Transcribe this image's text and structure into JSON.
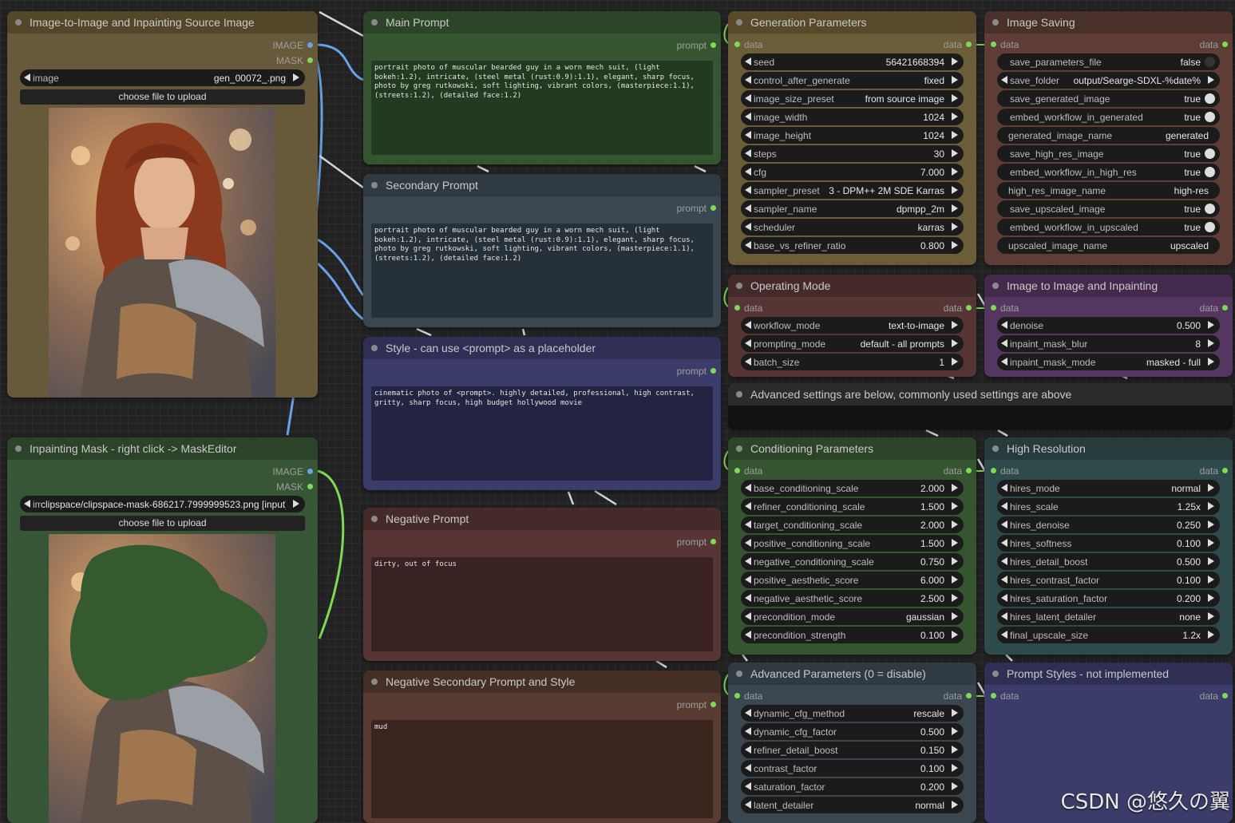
{
  "nodes": {
    "source_image": {
      "title": "Image-to-Image and Inpainting Source Image",
      "outputs": [
        "IMAGE",
        "MASK"
      ],
      "image_widget": {
        "label": "image",
        "value": "gen_00072_.png"
      },
      "upload_label": "choose file to upload"
    },
    "inpaint_mask": {
      "title": "Inpainting Mask - right click -> MaskEditor",
      "outputs": [
        "IMAGE",
        "MASK"
      ],
      "image_widget": {
        "label": "im",
        "value": "clipspace/clipspace-mask-686217.7999999523.png [input]"
      },
      "upload_label": "choose file to upload"
    },
    "main_prompt": {
      "title": "Main Prompt",
      "output": "prompt",
      "text": "portrait photo of muscular bearded guy in a worn mech suit, (light bokeh:1.2), intricate, (steel metal (rust:0.9):1.1), elegant, sharp focus, photo by greg rutkowski, soft lighting, vibrant colors, (masterpiece:1.1), (streets:1.2), (detailed face:1.2)"
    },
    "secondary_prompt": {
      "title": "Secondary Prompt",
      "output": "prompt",
      "text": "portrait photo of muscular bearded guy in a worn mech suit, (light bokeh:1.2), intricate, (steel metal (rust:0.9):1.1), elegant, sharp focus, photo by greg rutkowski, soft lighting, vibrant colors, (masterpiece:1.1), (streets:1.2), (detailed face:1.2)"
    },
    "style": {
      "title": "Style - can use <prompt> as a placeholder",
      "output": "prompt",
      "text": "cinematic photo of <prompt>. highly detailed, professional, high contrast, gritty, sharp focus, high budget hollywood movie"
    },
    "negative_prompt": {
      "title": "Negative Prompt",
      "output": "prompt",
      "text": "dirty, out of focus"
    },
    "negative_secondary": {
      "title": "Negative Secondary Prompt and Style",
      "output": "prompt",
      "text": "mud"
    },
    "generation": {
      "title": "Generation Parameters",
      "in": "data",
      "out": "data",
      "widgets": [
        {
          "label": "seed",
          "value": "56421668394"
        },
        {
          "label": "control_after_generate",
          "value": "fixed"
        },
        {
          "label": "image_size_preset",
          "value": "from source image"
        },
        {
          "label": "image_width",
          "value": "1024"
        },
        {
          "label": "image_height",
          "value": "1024"
        },
        {
          "label": "steps",
          "value": "30"
        },
        {
          "label": "cfg",
          "value": "7.000"
        },
        {
          "label": "sampler_preset",
          "value": "3 - DPM++ 2M SDE Karras"
        },
        {
          "label": "sampler_name",
          "value": "dpmpp_2m"
        },
        {
          "label": "scheduler",
          "value": "karras"
        },
        {
          "label": "base_vs_refiner_ratio",
          "value": "0.800"
        }
      ]
    },
    "image_saving": {
      "title": "Image Saving",
      "in": "data",
      "out": "data",
      "widgets": [
        {
          "label": "save_parameters_file",
          "value": "false",
          "toggle": "off"
        },
        {
          "label": "save_folder",
          "value": "output/Searge-SDXL-%date%"
        },
        {
          "label": "save_generated_image",
          "value": "true",
          "toggle": "on"
        },
        {
          "label": "embed_workflow_in_generated",
          "value": "true",
          "toggle": "on"
        },
        {
          "label": "generated_image_name",
          "value": "generated"
        },
        {
          "label": "save_high_res_image",
          "value": "true",
          "toggle": "on"
        },
        {
          "label": "embed_workflow_in_high_res",
          "value": "true",
          "toggle": "on"
        },
        {
          "label": "high_res_image_name",
          "value": "high-res"
        },
        {
          "label": "save_upscaled_image",
          "value": "true",
          "toggle": "on"
        },
        {
          "label": "embed_workflow_in_upscaled",
          "value": "true",
          "toggle": "on"
        },
        {
          "label": "upscaled_image_name",
          "value": "upscaled"
        }
      ]
    },
    "operating_mode": {
      "title": "Operating Mode",
      "in": "data",
      "out": "data",
      "widgets": [
        {
          "label": "workflow_mode",
          "value": "text-to-image"
        },
        {
          "label": "prompting_mode",
          "value": "default - all prompts"
        },
        {
          "label": "batch_size",
          "value": "1"
        }
      ]
    },
    "img2img": {
      "title": "Image to Image and Inpainting",
      "in": "data",
      "out": "data",
      "widgets": [
        {
          "label": "denoise",
          "value": "0.500"
        },
        {
          "label": "inpaint_mask_blur",
          "value": "8"
        },
        {
          "label": "inpaint_mask_mode",
          "value": "masked - full"
        }
      ]
    },
    "advanced_note": {
      "title": "Advanced settings are below, commonly used settings are above"
    },
    "conditioning": {
      "title": "Conditioning Parameters",
      "in": "data",
      "out": "data",
      "widgets": [
        {
          "label": "base_conditioning_scale",
          "value": "2.000"
        },
        {
          "label": "refiner_conditioning_scale",
          "value": "1.500"
        },
        {
          "label": "target_conditioning_scale",
          "value": "2.000"
        },
        {
          "label": "positive_conditioning_scale",
          "value": "1.500"
        },
        {
          "label": "negative_conditioning_scale",
          "value": "0.750"
        },
        {
          "label": "positive_aesthetic_score",
          "value": "6.000"
        },
        {
          "label": "negative_aesthetic_score",
          "value": "2.500"
        },
        {
          "label": "precondition_mode",
          "value": "gaussian"
        },
        {
          "label": "precondition_strength",
          "value": "0.100"
        }
      ]
    },
    "high_resolution": {
      "title": "High Resolution",
      "in": "data",
      "out": "data",
      "widgets": [
        {
          "label": "hires_mode",
          "value": "normal"
        },
        {
          "label": "hires_scale",
          "value": "1.25x"
        },
        {
          "label": "hires_denoise",
          "value": "0.250"
        },
        {
          "label": "hires_softness",
          "value": "0.100"
        },
        {
          "label": "hires_detail_boost",
          "value": "0.500"
        },
        {
          "label": "hires_contrast_factor",
          "value": "0.100"
        },
        {
          "label": "hires_saturation_factor",
          "value": "0.200"
        },
        {
          "label": "hires_latent_detailer",
          "value": "none"
        },
        {
          "label": "final_upscale_size",
          "value": "1.2x"
        }
      ]
    },
    "advanced_params": {
      "title": "Advanced Parameters (0 = disable)",
      "in": "data",
      "out": "data",
      "widgets": [
        {
          "label": "dynamic_cfg_method",
          "value": "rescale"
        },
        {
          "label": "dynamic_cfg_factor",
          "value": "0.500"
        },
        {
          "label": "refiner_detail_boost",
          "value": "0.150"
        },
        {
          "label": "contrast_factor",
          "value": "0.100"
        },
        {
          "label": "saturation_factor",
          "value": "0.200"
        },
        {
          "label": "latent_detailer",
          "value": "normal"
        }
      ]
    },
    "prompt_styles": {
      "title": "Prompt Styles - not implemented",
      "in": "data",
      "out": "data"
    }
  },
  "watermark": "CSDN @悠久の翼"
}
